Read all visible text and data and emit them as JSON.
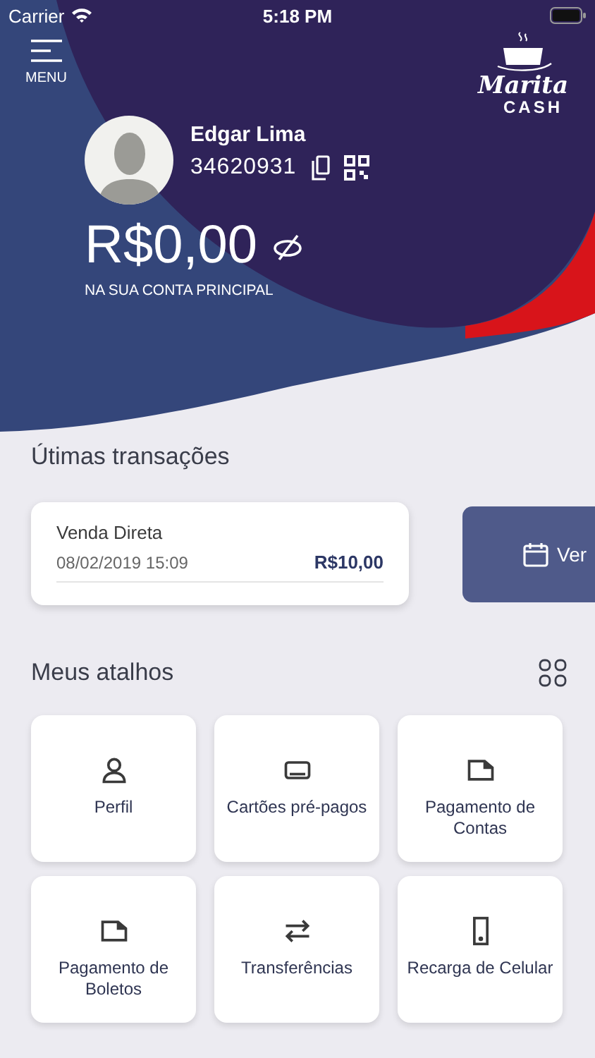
{
  "status_bar": {
    "carrier": "Carrier",
    "time": "5:18 PM"
  },
  "menu": {
    "label": "MENU"
  },
  "logo": {
    "title": "Marita",
    "subtitle": "CASH"
  },
  "profile": {
    "name": "Edgar Lima",
    "account": "34620931",
    "balance": "R$0,00",
    "balance_caption": "NA SUA CONTA PRINCIPAL"
  },
  "transactions": {
    "title": "Útimas transações",
    "items": [
      {
        "title": "Venda Direta",
        "date": "08/02/2019 15:09",
        "amount": "R$10,00"
      }
    ],
    "more_button": "Ver"
  },
  "shortcuts": {
    "title": "Meus atalhos",
    "items": [
      {
        "label": "Perfil",
        "kind": "person"
      },
      {
        "label": "Cartões pré-pagos",
        "kind": "card"
      },
      {
        "label": "Pagamento de Contas",
        "kind": "document"
      },
      {
        "label": "Pagamento de Boletos",
        "kind": "document"
      },
      {
        "label": "Transferências",
        "kind": "transfer"
      },
      {
        "label": "Recarga de Celular",
        "kind": "phone"
      }
    ]
  }
}
